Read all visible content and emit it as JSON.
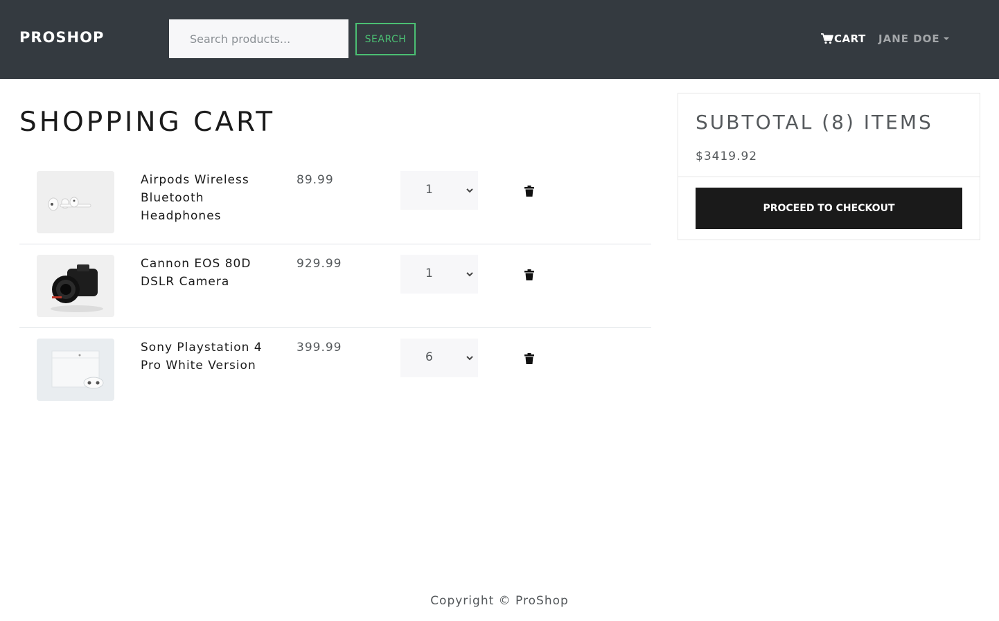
{
  "navbar": {
    "brand": "PROSHOP",
    "search_placeholder": "Search products...",
    "search_button": "SEARCH",
    "cart_label": "CART",
    "user_label": "JANE DOE"
  },
  "cart": {
    "title": "SHOPPING CART",
    "items": [
      {
        "name": "Airpods Wireless Bluetooth Headphones",
        "price": "89.99",
        "qty": "1",
        "image": "airpods-image"
      },
      {
        "name": "Cannon EOS 80D DSLR Camera",
        "price": "929.99",
        "qty": "1",
        "image": "camera-image"
      },
      {
        "name": "Sony Playstation 4 Pro White Version",
        "price": "399.99",
        "qty": "6",
        "image": "playstation-image"
      }
    ]
  },
  "summary": {
    "title": "SUBTOTAL (8) ITEMS",
    "total": "$3419.92",
    "checkout_button": "PROCEED TO CHECKOUT"
  },
  "footer": {
    "copyright": "Copyright © ProShop"
  },
  "colors": {
    "navbar_bg": "#343a40",
    "accent_green": "#4bbf73",
    "checkout_bg": "#1a1a1a"
  }
}
